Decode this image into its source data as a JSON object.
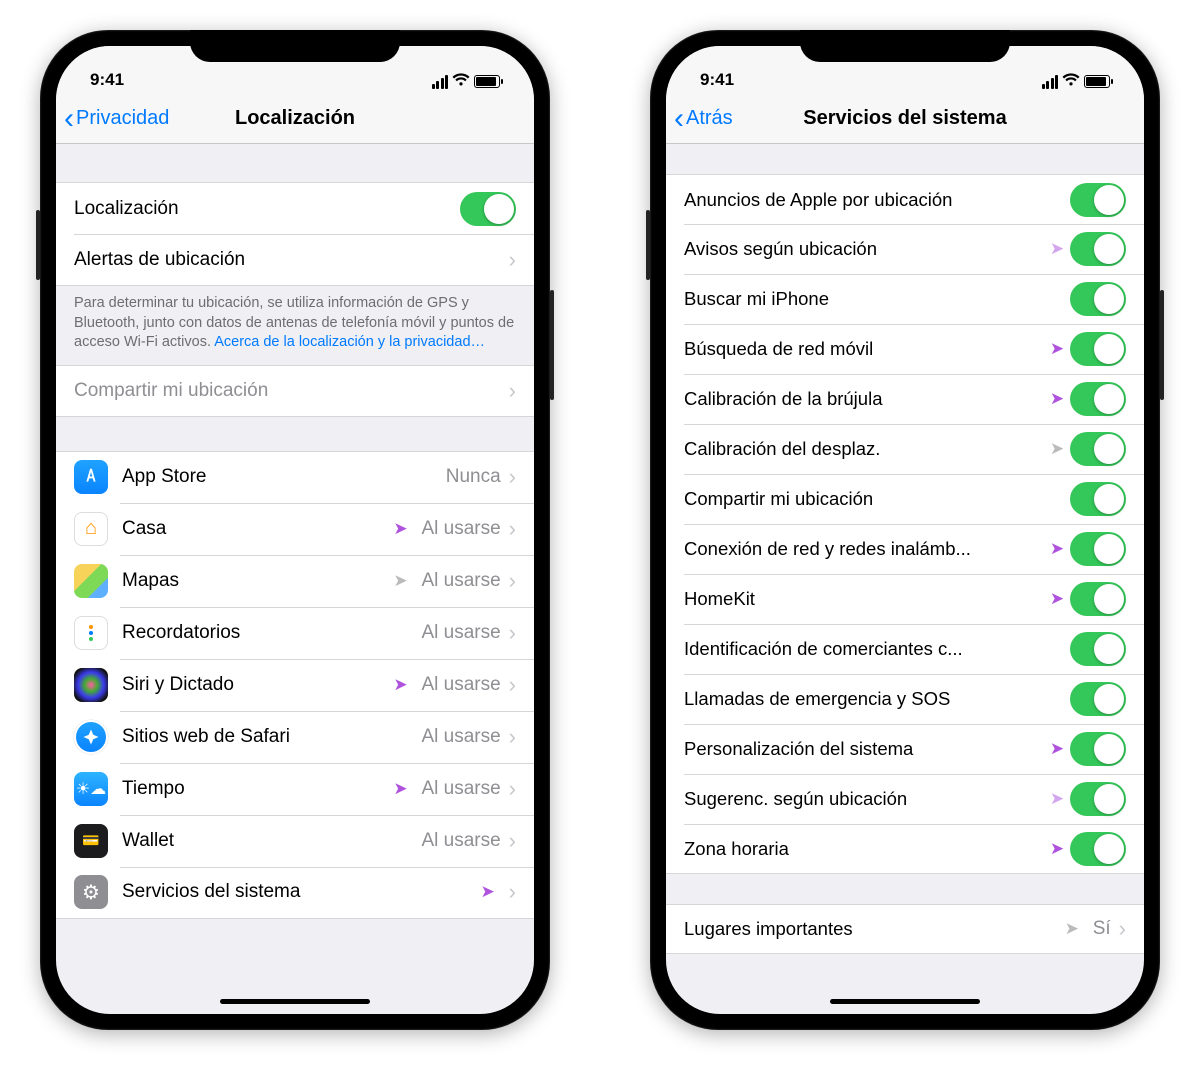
{
  "status": {
    "time": "9:41"
  },
  "phone1": {
    "back": "Privacidad",
    "title": "Localización",
    "localization_label": "Localización",
    "alerts_label": "Alertas de ubicación",
    "explain_text": "Para determinar tu ubicación, se utiliza información de GPS y Bluetooth, junto con datos de antenas de telefonía móvil y puntos de acceso Wi-Fi activos. ",
    "explain_link": "Acerca de la localización y la privacidad…",
    "share_label": "Compartir mi ubicación",
    "apps": [
      {
        "name": "App Store",
        "status": "Nunca",
        "icon": "appstore",
        "arrow": ""
      },
      {
        "name": "Casa",
        "status": "Al usarse",
        "icon": "casa",
        "arrow": "purple"
      },
      {
        "name": "Mapas",
        "status": "Al usarse",
        "icon": "mapas",
        "arrow": "gray"
      },
      {
        "name": "Recordatorios",
        "status": "Al usarse",
        "icon": "record",
        "arrow": ""
      },
      {
        "name": "Siri y Dictado",
        "status": "Al usarse",
        "icon": "siri",
        "arrow": "purple"
      },
      {
        "name": "Sitios web de Safari",
        "status": "Al usarse",
        "icon": "safari",
        "arrow": ""
      },
      {
        "name": "Tiempo",
        "status": "Al usarse",
        "icon": "tiempo",
        "arrow": "purple"
      },
      {
        "name": "Wallet",
        "status": "Al usarse",
        "icon": "wallet",
        "arrow": ""
      },
      {
        "name": "Servicios del sistema",
        "status": "",
        "icon": "gear",
        "arrow": "purple"
      }
    ]
  },
  "phone2": {
    "back": "Atrás",
    "title": "Servicios del sistema",
    "services": [
      {
        "label": "Anuncios de Apple por ubicación",
        "arrow": ""
      },
      {
        "label": "Avisos según ubicación",
        "arrow": "outline"
      },
      {
        "label": "Buscar mi iPhone",
        "arrow": ""
      },
      {
        "label": "Búsqueda de red móvil",
        "arrow": "purple"
      },
      {
        "label": "Calibración de la brújula",
        "arrow": "purple"
      },
      {
        "label": "Calibración del desplaz.",
        "arrow": "gray"
      },
      {
        "label": "Compartir mi ubicación",
        "arrow": ""
      },
      {
        "label": "Conexión de red y redes inalámb...",
        "arrow": "purple"
      },
      {
        "label": "HomeKit",
        "arrow": "purple"
      },
      {
        "label": "Identificación de comerciantes c...",
        "arrow": ""
      },
      {
        "label": "Llamadas de emergencia y SOS",
        "arrow": ""
      },
      {
        "label": "Personalización del sistema",
        "arrow": "purple"
      },
      {
        "label": "Sugerenc. según ubicación",
        "arrow": "outline"
      },
      {
        "label": "Zona horaria",
        "arrow": "purple"
      }
    ],
    "places_label": "Lugares importantes",
    "places_status": "Sí",
    "places_arrow": "gray"
  }
}
